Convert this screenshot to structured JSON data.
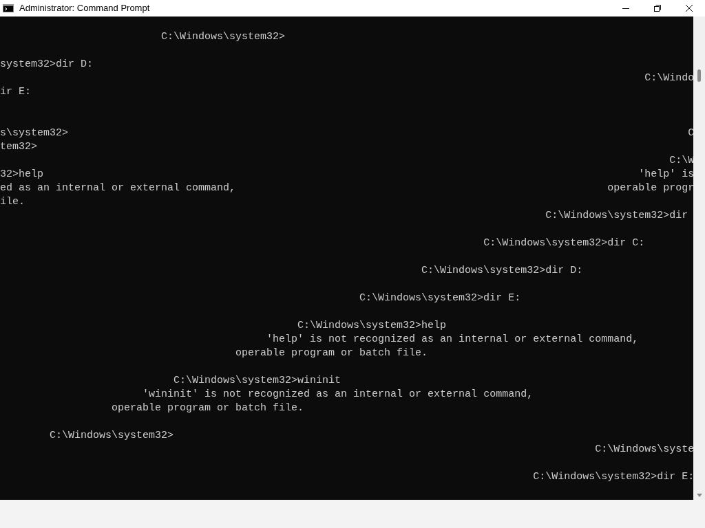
{
  "window": {
    "title": "Administrator: Command Prompt"
  },
  "console": {
    "lines": [
      {
        "segments": [
          "                          C:\\Windows\\system32>"
        ]
      },
      {
        "kind": "blank"
      },
      {
        "segments": [
          "system32>dir D:"
        ]
      },
      {
        "segments": [
          "                                                                                                        C:\\Windo"
        ]
      },
      {
        "segments": [
          "ir E:"
        ]
      },
      {
        "kind": "blank"
      },
      {
        "kind": "blank"
      },
      {
        "segments": [
          "s\\system32>",
          "                                                                                                    C"
        ]
      },
      {
        "segments": [
          "tem32>"
        ]
      },
      {
        "segments": [
          "                                                                                                            C:\\W"
        ]
      },
      {
        "segments": [
          "32>help",
          "                                                                                                'help' is"
        ]
      },
      {
        "segments": [
          "ed as an internal or external command,",
          "                                                            operable progr"
        ]
      },
      {
        "segments": [
          "ile."
        ]
      },
      {
        "segments": [
          "                                                                                        C:\\Windows\\system32>dir"
        ]
      },
      {
        "kind": "blank"
      },
      {
        "segments": [
          "                                                                              C:\\Windows\\system32>dir C:"
        ]
      },
      {
        "kind": "blank"
      },
      {
        "segments": [
          "                                                                    C:\\Windows\\system32>dir D:"
        ]
      },
      {
        "kind": "blank"
      },
      {
        "segments": [
          "                                                          C:\\Windows\\system32>dir E:"
        ]
      },
      {
        "kind": "blank"
      },
      {
        "segments": [
          "                                                C:\\Windows\\system32>help"
        ]
      },
      {
        "segments": [
          "                                           'help' is not recognized as an internal or external command,"
        ]
      },
      {
        "segments": [
          "                                      operable program or batch file."
        ]
      },
      {
        "kind": "blank"
      },
      {
        "segments": [
          "                            C:\\Windows\\system32>wininit"
        ]
      },
      {
        "segments": [
          "                       'wininit' is not recognized as an internal or external command,"
        ]
      },
      {
        "segments": [
          "                  operable program or batch file."
        ]
      },
      {
        "kind": "blank"
      },
      {
        "segments": [
          "        C:\\Windows\\system32>"
        ]
      },
      {
        "segments": [
          "                                                                                                C:\\Windows\\syste"
        ]
      },
      {
        "kind": "blank"
      },
      {
        "segments": [
          "                                                                                      C:\\Windows\\system32>dir E:"
        ]
      }
    ]
  }
}
